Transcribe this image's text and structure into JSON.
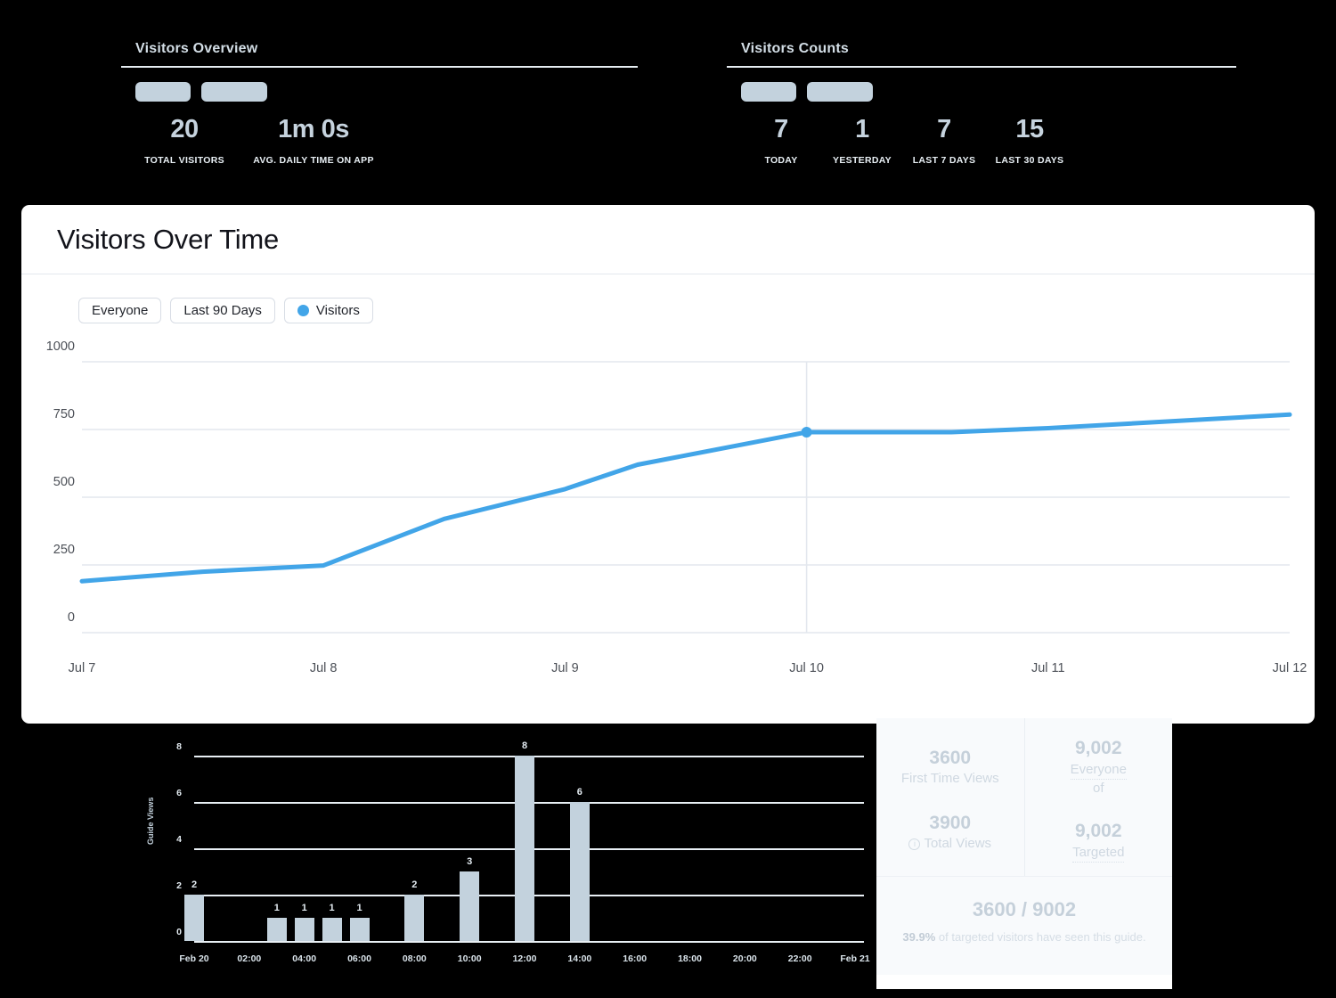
{
  "summaries": [
    {
      "title": "Visitors Overview",
      "skeletons": 2,
      "metrics": [
        {
          "value": "20",
          "label": "TOTAL VISITORS"
        },
        {
          "value": "1m 0s",
          "label": "AVG. DAILY TIME ON APP"
        }
      ]
    },
    {
      "title": "Visitors Counts",
      "skeletons": 2,
      "metrics": [
        {
          "value": "7",
          "label": "TODAY"
        },
        {
          "value": "1",
          "label": "YESTERDAY"
        },
        {
          "value": "7",
          "label": "LAST 7 DAYS"
        },
        {
          "value": "15",
          "label": "LAST 30 DAYS"
        }
      ]
    }
  ],
  "card": {
    "title": "Visitors Over Time",
    "filters": [
      {
        "label": "Everyone",
        "has_dot": false
      },
      {
        "label": "Last 90 Days",
        "has_dot": false
      },
      {
        "label": "Visitors",
        "has_dot": true
      }
    ]
  },
  "bar_axis_title": "Guide Views",
  "stats": {
    "first_time_views_value": "3600",
    "first_time_views_label": "First Time Views",
    "total_views_value": "3900",
    "total_views_label": "Total Views",
    "everyone_value": "9,002",
    "everyone_label": "Everyone",
    "of_label": "of",
    "targeted_value": "9,002",
    "targeted_label": "Targeted",
    "ratio": "3600 / 9002",
    "percent": "39.9%",
    "caption_rest": " of targeted visitors have seen this guide."
  },
  "colors": {
    "line": "#42a5e8",
    "grid": "#e3e7ee",
    "bar": "#c3d2dd",
    "skeleton": "#c3d2dd",
    "card_bg": "#ffffff",
    "page_bg": "#000000"
  },
  "chart_data": [
    {
      "type": "line",
      "title": "Visitors Over Time",
      "xlabel": "",
      "ylabel": "",
      "ylim": [
        0,
        1000
      ],
      "yticks": [
        0,
        250,
        500,
        750,
        1000
      ],
      "xticks": [
        "Jul 7",
        "Jul 8",
        "Jul 9",
        "Jul 10",
        "Jul 11",
        "Jul 12"
      ],
      "grid": true,
      "legend": [
        "Visitors"
      ],
      "legend_position": "top-left",
      "marker_x": "Jul 10",
      "marker_y": 740,
      "series": [
        {
          "name": "Visitors",
          "x": [
            "Jul 7",
            "Jul 7.5",
            "Jul 8",
            "Jul 8.5",
            "Jul 9",
            "Jul 9.3",
            "Jul 10",
            "Jul 10.6",
            "Jul 11",
            "Jul 12"
          ],
          "values": [
            190,
            225,
            248,
            420,
            530,
            620,
            740,
            740,
            755,
            805
          ]
        }
      ]
    },
    {
      "type": "bar",
      "title": "",
      "xlabel": "",
      "ylabel": "Guide Views",
      "ylim": [
        0,
        8
      ],
      "yticks": [
        0,
        2,
        4,
        6,
        8
      ],
      "categories": [
        "Feb 20",
        "01:00",
        "02:00",
        "03:00",
        "04:00",
        "05:00",
        "06:00",
        "07:00",
        "08:00",
        "09:00",
        "10:00",
        "11:00",
        "12:00",
        "13:00",
        "14:00",
        "15:00",
        "16:00",
        "17:00",
        "18:00",
        "19:00",
        "20:00",
        "21:00",
        "22:00",
        "23:00",
        "Feb 21"
      ],
      "values": [
        2,
        0,
        0,
        1,
        1,
        1,
        1,
        0,
        2,
        0,
        3,
        0,
        8,
        0,
        6,
        0,
        0,
        0,
        0,
        0,
        0,
        0,
        0,
        0,
        0
      ],
      "xticks": [
        "Feb 20",
        "02:00",
        "04:00",
        "06:00",
        "08:00",
        "10:00",
        "12:00",
        "14:00",
        "16:00",
        "18:00",
        "20:00",
        "22:00",
        "Feb 21"
      ],
      "grid": true
    }
  ]
}
